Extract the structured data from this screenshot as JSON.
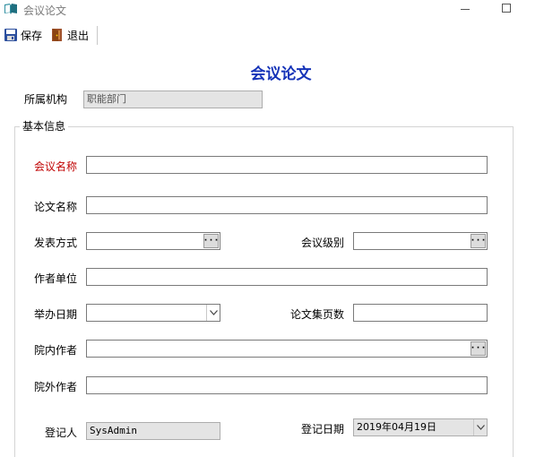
{
  "window": {
    "title": "会议论文"
  },
  "toolbar": {
    "save_label": "保存",
    "exit_label": "退出"
  },
  "form": {
    "title": "会议论文"
  },
  "org": {
    "label": "所属机构",
    "value": "职能部门"
  },
  "group": {
    "caption": "基本信息"
  },
  "fields": {
    "meeting_name": {
      "label": "会议名称",
      "value": ""
    },
    "paper_name": {
      "label": "论文名称",
      "value": ""
    },
    "publish_method": {
      "label": "发表方式",
      "value": ""
    },
    "meeting_level": {
      "label": "会议级别",
      "value": ""
    },
    "author_unit": {
      "label": "作者单位",
      "value": ""
    },
    "held_date": {
      "label": "举办日期",
      "value": ""
    },
    "proceedings_pages": {
      "label": "论文集页数",
      "value": ""
    },
    "internal_authors": {
      "label": "院内作者",
      "value": ""
    },
    "external_authors": {
      "label": "院外作者",
      "value": ""
    }
  },
  "registrar": {
    "label": "登记人",
    "value": "SysAdmin"
  },
  "reg_date": {
    "label": "登记日期",
    "value": "2019年04月19日"
  },
  "icons": {
    "lookup": "ellipsis-button",
    "dropdown": "chevron-down-icon"
  }
}
